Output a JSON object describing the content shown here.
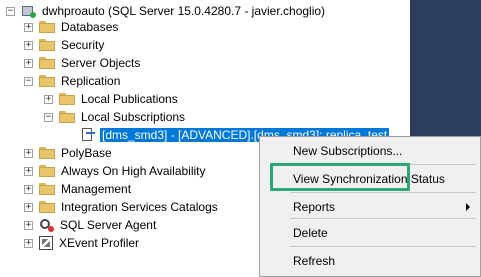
{
  "tree": {
    "server": "dwhproauto (SQL Server 15.0.4280.7 - javier.choglio)",
    "items": [
      {
        "label": "Databases",
        "exp": "+"
      },
      {
        "label": "Security",
        "exp": "+"
      },
      {
        "label": "Server Objects",
        "exp": "+"
      },
      {
        "label": "Replication",
        "exp": "−"
      },
      {
        "label": "Local Publications",
        "exp": "+"
      },
      {
        "label": "Local Subscriptions",
        "exp": "−"
      },
      {
        "label": "[dms_smd3] - [ADVANCED].[dms_smd3]: replica_test"
      },
      {
        "label": "PolyBase",
        "exp": "+"
      },
      {
        "label": "Always On High Availability",
        "exp": "+"
      },
      {
        "label": "Management",
        "exp": "+"
      },
      {
        "label": "Integration Services Catalogs",
        "exp": "+"
      },
      {
        "label": "SQL Server Agent",
        "exp": "+"
      },
      {
        "label": "XEvent Profiler",
        "exp": "+"
      }
    ]
  },
  "context_menu": {
    "new_subscriptions": "New Subscriptions...",
    "view_sync_status": "View Synchronization Status",
    "reports": "Reports",
    "delete": "Delete",
    "refresh": "Refresh"
  },
  "colors": {
    "selection": "#0078d7",
    "highlight_box": "#2ea776",
    "right_panel": "#2c3e5c"
  }
}
